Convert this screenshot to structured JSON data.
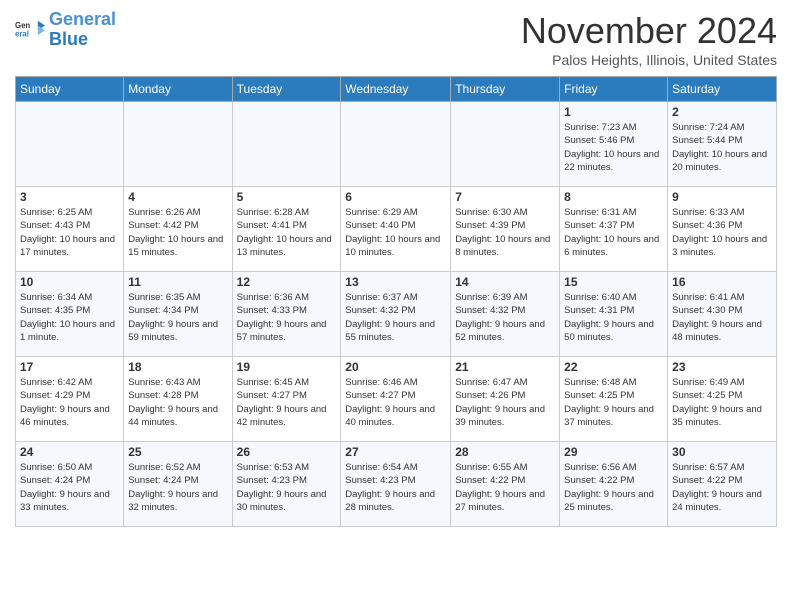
{
  "header": {
    "logo_line1": "General",
    "logo_line2": "Blue",
    "month_title": "November 2024",
    "location": "Palos Heights, Illinois, United States"
  },
  "weekdays": [
    "Sunday",
    "Monday",
    "Tuesday",
    "Wednesday",
    "Thursday",
    "Friday",
    "Saturday"
  ],
  "weeks": [
    [
      {
        "day": "",
        "info": ""
      },
      {
        "day": "",
        "info": ""
      },
      {
        "day": "",
        "info": ""
      },
      {
        "day": "",
        "info": ""
      },
      {
        "day": "",
        "info": ""
      },
      {
        "day": "1",
        "info": "Sunrise: 7:23 AM\nSunset: 5:46 PM\nDaylight: 10 hours and 22 minutes."
      },
      {
        "day": "2",
        "info": "Sunrise: 7:24 AM\nSunset: 5:44 PM\nDaylight: 10 hours and 20 minutes."
      }
    ],
    [
      {
        "day": "3",
        "info": "Sunrise: 6:25 AM\nSunset: 4:43 PM\nDaylight: 10 hours and 17 minutes."
      },
      {
        "day": "4",
        "info": "Sunrise: 6:26 AM\nSunset: 4:42 PM\nDaylight: 10 hours and 15 minutes."
      },
      {
        "day": "5",
        "info": "Sunrise: 6:28 AM\nSunset: 4:41 PM\nDaylight: 10 hours and 13 minutes."
      },
      {
        "day": "6",
        "info": "Sunrise: 6:29 AM\nSunset: 4:40 PM\nDaylight: 10 hours and 10 minutes."
      },
      {
        "day": "7",
        "info": "Sunrise: 6:30 AM\nSunset: 4:39 PM\nDaylight: 10 hours and 8 minutes."
      },
      {
        "day": "8",
        "info": "Sunrise: 6:31 AM\nSunset: 4:37 PM\nDaylight: 10 hours and 6 minutes."
      },
      {
        "day": "9",
        "info": "Sunrise: 6:33 AM\nSunset: 4:36 PM\nDaylight: 10 hours and 3 minutes."
      }
    ],
    [
      {
        "day": "10",
        "info": "Sunrise: 6:34 AM\nSunset: 4:35 PM\nDaylight: 10 hours and 1 minute."
      },
      {
        "day": "11",
        "info": "Sunrise: 6:35 AM\nSunset: 4:34 PM\nDaylight: 9 hours and 59 minutes."
      },
      {
        "day": "12",
        "info": "Sunrise: 6:36 AM\nSunset: 4:33 PM\nDaylight: 9 hours and 57 minutes."
      },
      {
        "day": "13",
        "info": "Sunrise: 6:37 AM\nSunset: 4:32 PM\nDaylight: 9 hours and 55 minutes."
      },
      {
        "day": "14",
        "info": "Sunrise: 6:39 AM\nSunset: 4:32 PM\nDaylight: 9 hours and 52 minutes."
      },
      {
        "day": "15",
        "info": "Sunrise: 6:40 AM\nSunset: 4:31 PM\nDaylight: 9 hours and 50 minutes."
      },
      {
        "day": "16",
        "info": "Sunrise: 6:41 AM\nSunset: 4:30 PM\nDaylight: 9 hours and 48 minutes."
      }
    ],
    [
      {
        "day": "17",
        "info": "Sunrise: 6:42 AM\nSunset: 4:29 PM\nDaylight: 9 hours and 46 minutes."
      },
      {
        "day": "18",
        "info": "Sunrise: 6:43 AM\nSunset: 4:28 PM\nDaylight: 9 hours and 44 minutes."
      },
      {
        "day": "19",
        "info": "Sunrise: 6:45 AM\nSunset: 4:27 PM\nDaylight: 9 hours and 42 minutes."
      },
      {
        "day": "20",
        "info": "Sunrise: 6:46 AM\nSunset: 4:27 PM\nDaylight: 9 hours and 40 minutes."
      },
      {
        "day": "21",
        "info": "Sunrise: 6:47 AM\nSunset: 4:26 PM\nDaylight: 9 hours and 39 minutes."
      },
      {
        "day": "22",
        "info": "Sunrise: 6:48 AM\nSunset: 4:25 PM\nDaylight: 9 hours and 37 minutes."
      },
      {
        "day": "23",
        "info": "Sunrise: 6:49 AM\nSunset: 4:25 PM\nDaylight: 9 hours and 35 minutes."
      }
    ],
    [
      {
        "day": "24",
        "info": "Sunrise: 6:50 AM\nSunset: 4:24 PM\nDaylight: 9 hours and 33 minutes."
      },
      {
        "day": "25",
        "info": "Sunrise: 6:52 AM\nSunset: 4:24 PM\nDaylight: 9 hours and 32 minutes."
      },
      {
        "day": "26",
        "info": "Sunrise: 6:53 AM\nSunset: 4:23 PM\nDaylight: 9 hours and 30 minutes."
      },
      {
        "day": "27",
        "info": "Sunrise: 6:54 AM\nSunset: 4:23 PM\nDaylight: 9 hours and 28 minutes."
      },
      {
        "day": "28",
        "info": "Sunrise: 6:55 AM\nSunset: 4:22 PM\nDaylight: 9 hours and 27 minutes."
      },
      {
        "day": "29",
        "info": "Sunrise: 6:56 AM\nSunset: 4:22 PM\nDaylight: 9 hours and 25 minutes."
      },
      {
        "day": "30",
        "info": "Sunrise: 6:57 AM\nSunset: 4:22 PM\nDaylight: 9 hours and 24 minutes."
      }
    ]
  ]
}
